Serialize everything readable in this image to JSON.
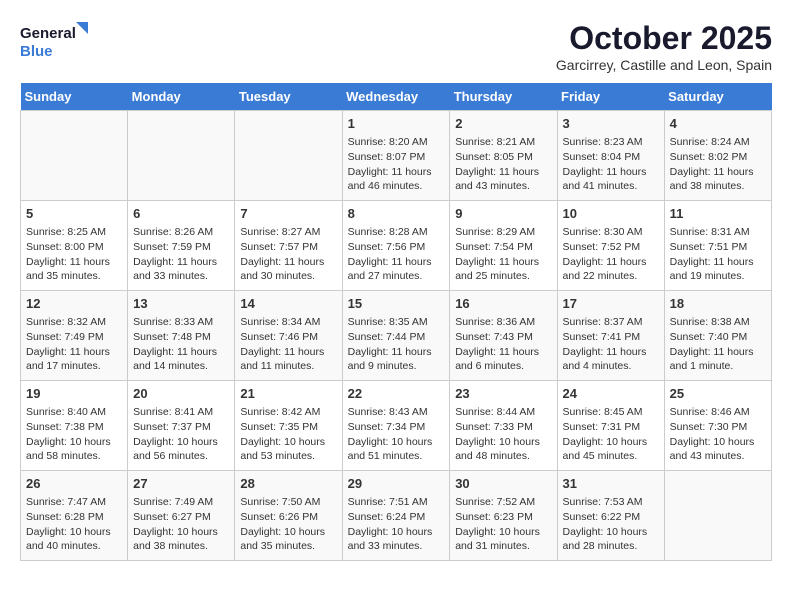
{
  "logo": {
    "line1": "General",
    "line2": "Blue"
  },
  "title": "October 2025",
  "location": "Garcirrey, Castille and Leon, Spain",
  "weekdays": [
    "Sunday",
    "Monday",
    "Tuesday",
    "Wednesday",
    "Thursday",
    "Friday",
    "Saturday"
  ],
  "weeks": [
    [
      {
        "day": "",
        "info": ""
      },
      {
        "day": "",
        "info": ""
      },
      {
        "day": "",
        "info": ""
      },
      {
        "day": "1",
        "info": "Sunrise: 8:20 AM\nSunset: 8:07 PM\nDaylight: 11 hours\nand 46 minutes."
      },
      {
        "day": "2",
        "info": "Sunrise: 8:21 AM\nSunset: 8:05 PM\nDaylight: 11 hours\nand 43 minutes."
      },
      {
        "day": "3",
        "info": "Sunrise: 8:23 AM\nSunset: 8:04 PM\nDaylight: 11 hours\nand 41 minutes."
      },
      {
        "day": "4",
        "info": "Sunrise: 8:24 AM\nSunset: 8:02 PM\nDaylight: 11 hours\nand 38 minutes."
      }
    ],
    [
      {
        "day": "5",
        "info": "Sunrise: 8:25 AM\nSunset: 8:00 PM\nDaylight: 11 hours\nand 35 minutes."
      },
      {
        "day": "6",
        "info": "Sunrise: 8:26 AM\nSunset: 7:59 PM\nDaylight: 11 hours\nand 33 minutes."
      },
      {
        "day": "7",
        "info": "Sunrise: 8:27 AM\nSunset: 7:57 PM\nDaylight: 11 hours\nand 30 minutes."
      },
      {
        "day": "8",
        "info": "Sunrise: 8:28 AM\nSunset: 7:56 PM\nDaylight: 11 hours\nand 27 minutes."
      },
      {
        "day": "9",
        "info": "Sunrise: 8:29 AM\nSunset: 7:54 PM\nDaylight: 11 hours\nand 25 minutes."
      },
      {
        "day": "10",
        "info": "Sunrise: 8:30 AM\nSunset: 7:52 PM\nDaylight: 11 hours\nand 22 minutes."
      },
      {
        "day": "11",
        "info": "Sunrise: 8:31 AM\nSunset: 7:51 PM\nDaylight: 11 hours\nand 19 minutes."
      }
    ],
    [
      {
        "day": "12",
        "info": "Sunrise: 8:32 AM\nSunset: 7:49 PM\nDaylight: 11 hours\nand 17 minutes."
      },
      {
        "day": "13",
        "info": "Sunrise: 8:33 AM\nSunset: 7:48 PM\nDaylight: 11 hours\nand 14 minutes."
      },
      {
        "day": "14",
        "info": "Sunrise: 8:34 AM\nSunset: 7:46 PM\nDaylight: 11 hours\nand 11 minutes."
      },
      {
        "day": "15",
        "info": "Sunrise: 8:35 AM\nSunset: 7:44 PM\nDaylight: 11 hours\nand 9 minutes."
      },
      {
        "day": "16",
        "info": "Sunrise: 8:36 AM\nSunset: 7:43 PM\nDaylight: 11 hours\nand 6 minutes."
      },
      {
        "day": "17",
        "info": "Sunrise: 8:37 AM\nSunset: 7:41 PM\nDaylight: 11 hours\nand 4 minutes."
      },
      {
        "day": "18",
        "info": "Sunrise: 8:38 AM\nSunset: 7:40 PM\nDaylight: 11 hours\nand 1 minute."
      }
    ],
    [
      {
        "day": "19",
        "info": "Sunrise: 8:40 AM\nSunset: 7:38 PM\nDaylight: 10 hours\nand 58 minutes."
      },
      {
        "day": "20",
        "info": "Sunrise: 8:41 AM\nSunset: 7:37 PM\nDaylight: 10 hours\nand 56 minutes."
      },
      {
        "day": "21",
        "info": "Sunrise: 8:42 AM\nSunset: 7:35 PM\nDaylight: 10 hours\nand 53 minutes."
      },
      {
        "day": "22",
        "info": "Sunrise: 8:43 AM\nSunset: 7:34 PM\nDaylight: 10 hours\nand 51 minutes."
      },
      {
        "day": "23",
        "info": "Sunrise: 8:44 AM\nSunset: 7:33 PM\nDaylight: 10 hours\nand 48 minutes."
      },
      {
        "day": "24",
        "info": "Sunrise: 8:45 AM\nSunset: 7:31 PM\nDaylight: 10 hours\nand 45 minutes."
      },
      {
        "day": "25",
        "info": "Sunrise: 8:46 AM\nSunset: 7:30 PM\nDaylight: 10 hours\nand 43 minutes."
      }
    ],
    [
      {
        "day": "26",
        "info": "Sunrise: 7:47 AM\nSunset: 6:28 PM\nDaylight: 10 hours\nand 40 minutes."
      },
      {
        "day": "27",
        "info": "Sunrise: 7:49 AM\nSunset: 6:27 PM\nDaylight: 10 hours\nand 38 minutes."
      },
      {
        "day": "28",
        "info": "Sunrise: 7:50 AM\nSunset: 6:26 PM\nDaylight: 10 hours\nand 35 minutes."
      },
      {
        "day": "29",
        "info": "Sunrise: 7:51 AM\nSunset: 6:24 PM\nDaylight: 10 hours\nand 33 minutes."
      },
      {
        "day": "30",
        "info": "Sunrise: 7:52 AM\nSunset: 6:23 PM\nDaylight: 10 hours\nand 31 minutes."
      },
      {
        "day": "31",
        "info": "Sunrise: 7:53 AM\nSunset: 6:22 PM\nDaylight: 10 hours\nand 28 minutes."
      },
      {
        "day": "",
        "info": ""
      }
    ]
  ]
}
